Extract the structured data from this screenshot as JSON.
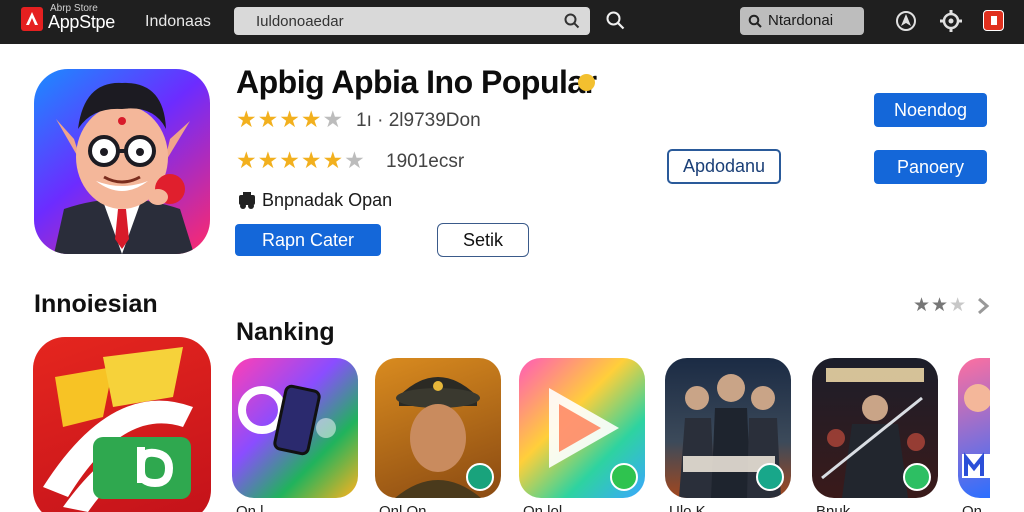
{
  "header": {
    "logo_small": "Abrp Store",
    "logo_big": "AppStpe",
    "region": "Indonaas",
    "search_value": "Iuldonoaedar",
    "account_label": "Ntardonai"
  },
  "featured": {
    "title": "Apbig Apbia Ino Popular",
    "rating_1_text": "1ı · 2l9739Don",
    "rating_2_text": "1901ecsr",
    "developer": "Bnpnadak Opan",
    "btn_primary": "Rapn Cater",
    "btn_secondary": "Setik",
    "btn_middle": "Apdodanu",
    "btn_right_1": "Noendog",
    "btn_right_2": "Panoery"
  },
  "sections": {
    "left_title": "Innoiesian",
    "main_title": "Nanking"
  },
  "tiles": [
    {
      "caption": "On l"
    },
    {
      "caption": "Onl On"
    },
    {
      "caption": "On lol"
    },
    {
      "caption": "Ulo K"
    },
    {
      "caption": "Bnuk"
    },
    {
      "caption": "On"
    }
  ],
  "colors": {
    "accent": "#1467d9",
    "star": "#f2b01e",
    "topbar": "#1f1f1f"
  }
}
